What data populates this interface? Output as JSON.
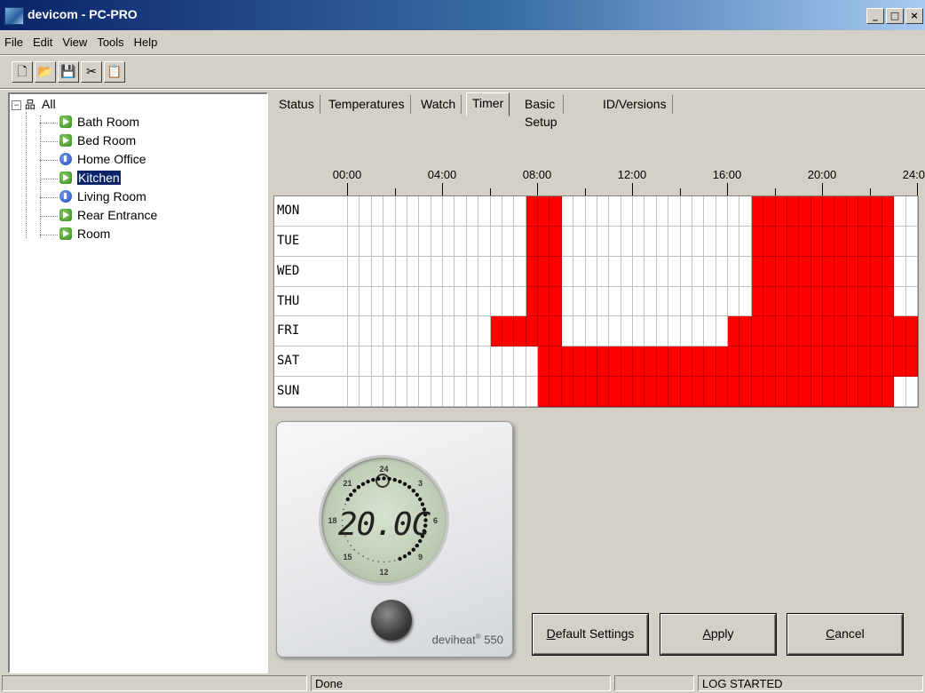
{
  "window": {
    "title": "devicom - PC-PRO",
    "controls": {
      "minimize": "_",
      "maximize": "□",
      "close": "×"
    }
  },
  "menu": [
    "File",
    "Edit",
    "View",
    "Tools",
    "Help"
  ],
  "toolbar": {
    "buttons": [
      {
        "name": "new-icon",
        "glyph": "🗋"
      },
      {
        "name": "open-icon",
        "glyph": "📂"
      },
      {
        "name": "save-icon",
        "glyph": "💾"
      },
      {
        "name": "cut-icon",
        "glyph": "✂"
      },
      {
        "name": "paste-icon",
        "glyph": "📋"
      }
    ]
  },
  "tree": {
    "root": "All",
    "rooms": [
      {
        "label": "Bath Room",
        "status": "green"
      },
      {
        "label": "Bed Room",
        "status": "green"
      },
      {
        "label": "Home Office",
        "status": "blue"
      },
      {
        "label": "Kitchen",
        "status": "green",
        "selected": true
      },
      {
        "label": "Living Room",
        "status": "blue"
      },
      {
        "label": "Rear Entrance",
        "status": "green"
      },
      {
        "label": "Room",
        "status": "green"
      }
    ]
  },
  "tabs": [
    {
      "label": "Status"
    },
    {
      "label": "Temperatures"
    },
    {
      "label": "Watch"
    },
    {
      "label": "Timer",
      "active": true
    },
    {
      "label": "Basic Setup"
    },
    {
      "label": "ID/Versions"
    }
  ],
  "timer": {
    "time_labels": [
      "00:00",
      "04:00",
      "08:00",
      "12:00",
      "16:00",
      "20:00",
      "24:00"
    ],
    "slots_per_day": 48,
    "days": [
      {
        "label": "MON",
        "on_ranges": [
          [
            7.5,
            9
          ],
          [
            17,
            23
          ]
        ]
      },
      {
        "label": "TUE",
        "on_ranges": [
          [
            7.5,
            9
          ],
          [
            17,
            23
          ]
        ]
      },
      {
        "label": "WED",
        "on_ranges": [
          [
            7.5,
            9
          ],
          [
            17,
            23
          ]
        ]
      },
      {
        "label": "THU",
        "on_ranges": [
          [
            7.5,
            9
          ],
          [
            17,
            23
          ]
        ]
      },
      {
        "label": "FRI",
        "on_ranges": [
          [
            6,
            9
          ],
          [
            16,
            24
          ]
        ]
      },
      {
        "label": "SAT",
        "on_ranges": [
          [
            8,
            24
          ]
        ]
      },
      {
        "label": "SUN",
        "on_ranges": [
          [
            8,
            23
          ]
        ]
      }
    ],
    "colors": {
      "on": "#ff0000",
      "off": "#ffffff"
    }
  },
  "thermostat": {
    "temperature": "20.0C",
    "dial_numbers": [
      "24",
      "3",
      "6",
      "9",
      "12",
      "15",
      "18",
      "21"
    ],
    "brand": "deviheat",
    "registered": "®",
    "model": "550"
  },
  "buttons": {
    "default_settings": "Default Settings",
    "apply": "Apply",
    "cancel": "Cancel"
  },
  "status": {
    "message": "Done",
    "log": "LOG STARTED"
  }
}
